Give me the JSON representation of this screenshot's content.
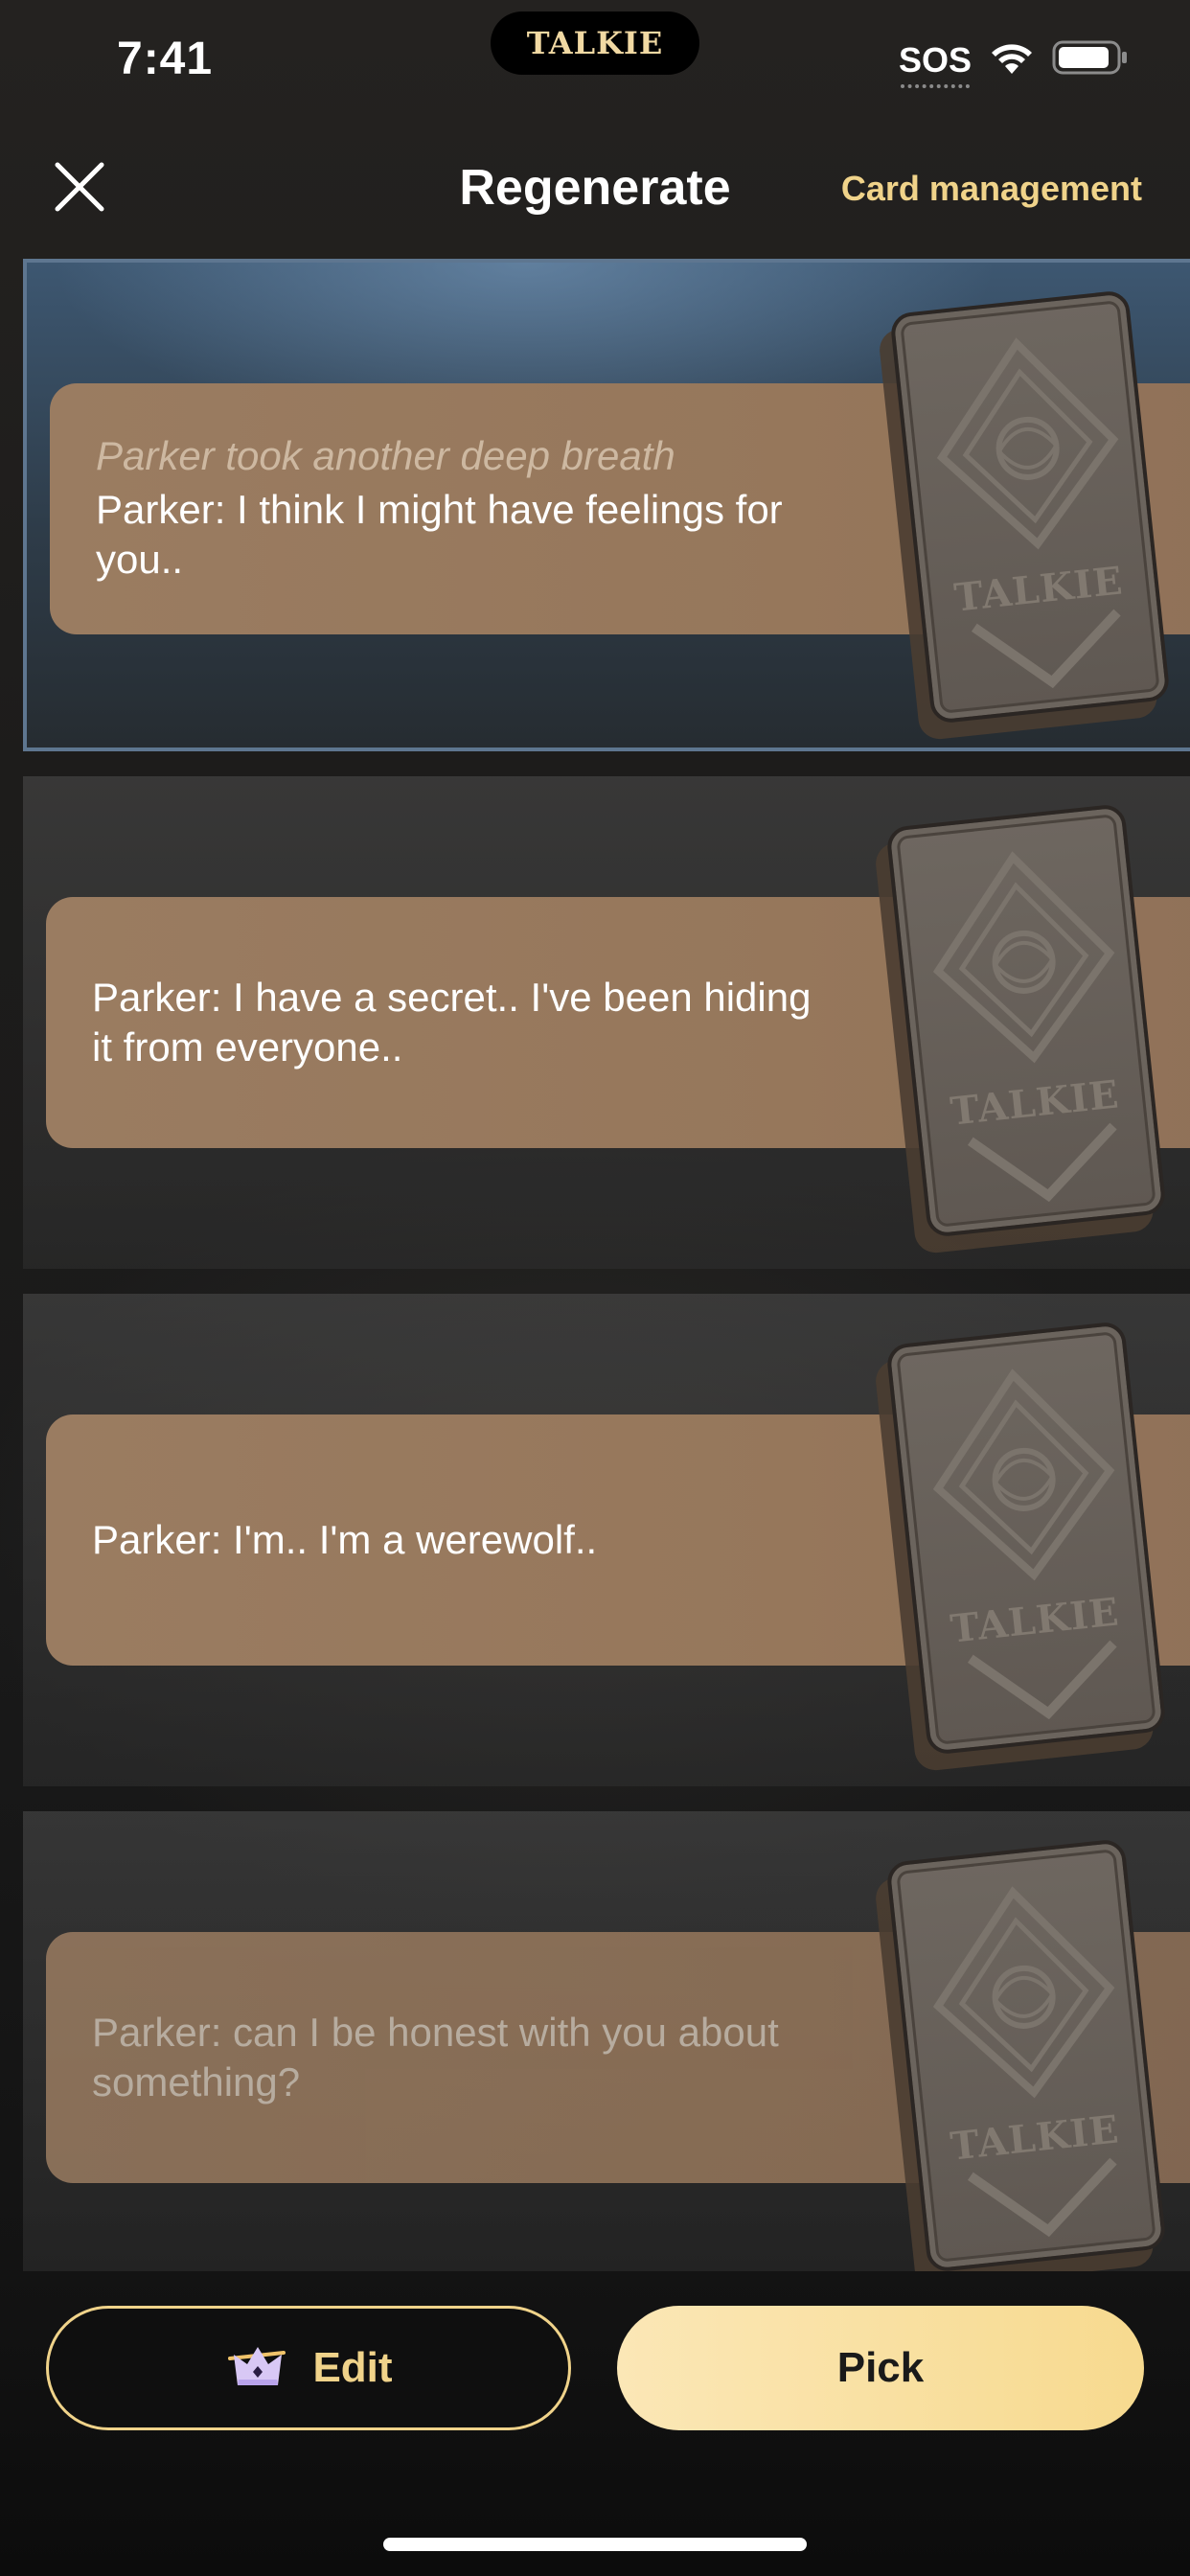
{
  "status_bar": {
    "time": "7:41",
    "island_logo": "TALKIE",
    "sos": "SOS"
  },
  "header": {
    "title": "Regenerate",
    "card_management": "Card management"
  },
  "options": [
    {
      "narration": "Parker took another deep breath",
      "text": "Parker: I think I might have feelings for you..",
      "card_logo": "TALKIE"
    },
    {
      "text": "Parker: I have a secret.. I've been hiding it from everyone..",
      "card_logo": "TALKIE"
    },
    {
      "text": "Parker: I'm.. I'm a werewolf..",
      "card_logo": "TALKIE"
    },
    {
      "text": "Parker: can I be honest with you about something?",
      "card_logo": "TALKIE"
    }
  ],
  "actions": {
    "edit_label": "Edit",
    "pick_label": "Pick"
  },
  "colors": {
    "accent_gold": "#f0d38a",
    "selected_border": "#5e7690",
    "speech_band": "#9a7c61"
  },
  "icons": {
    "close": "close-icon",
    "edit": "crown-icon",
    "signal": "wifi-icon",
    "battery": "battery-icon"
  }
}
